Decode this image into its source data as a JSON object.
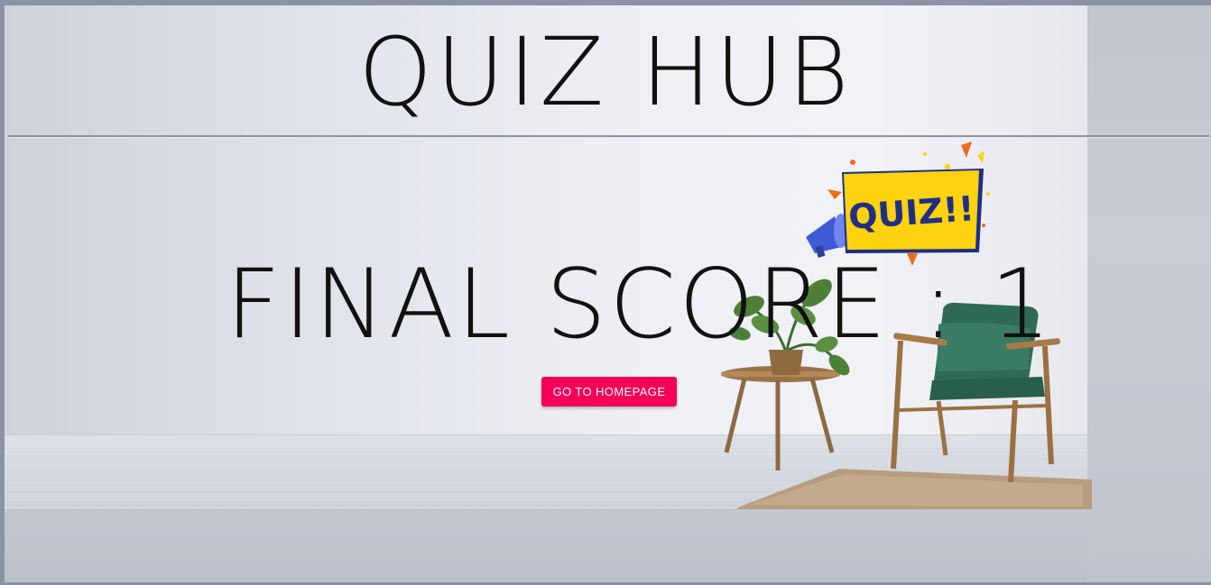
{
  "header": {
    "title": "QUIZ HUB"
  },
  "result": {
    "score_label": "FINAL SCORE : 1"
  },
  "actions": {
    "homepage_button": "GO TO HOMEPAGE"
  },
  "badge": {
    "text": "QUIZ!!"
  },
  "colors": {
    "accent": "#f50057",
    "badge_yellow": "#fdd20e",
    "badge_text": "#1f2f86",
    "chair_green": "#2f6a56"
  },
  "icons": [
    "megaphone-icon",
    "plant-icon",
    "chair-icon",
    "side-table-icon",
    "rug-icon"
  ]
}
